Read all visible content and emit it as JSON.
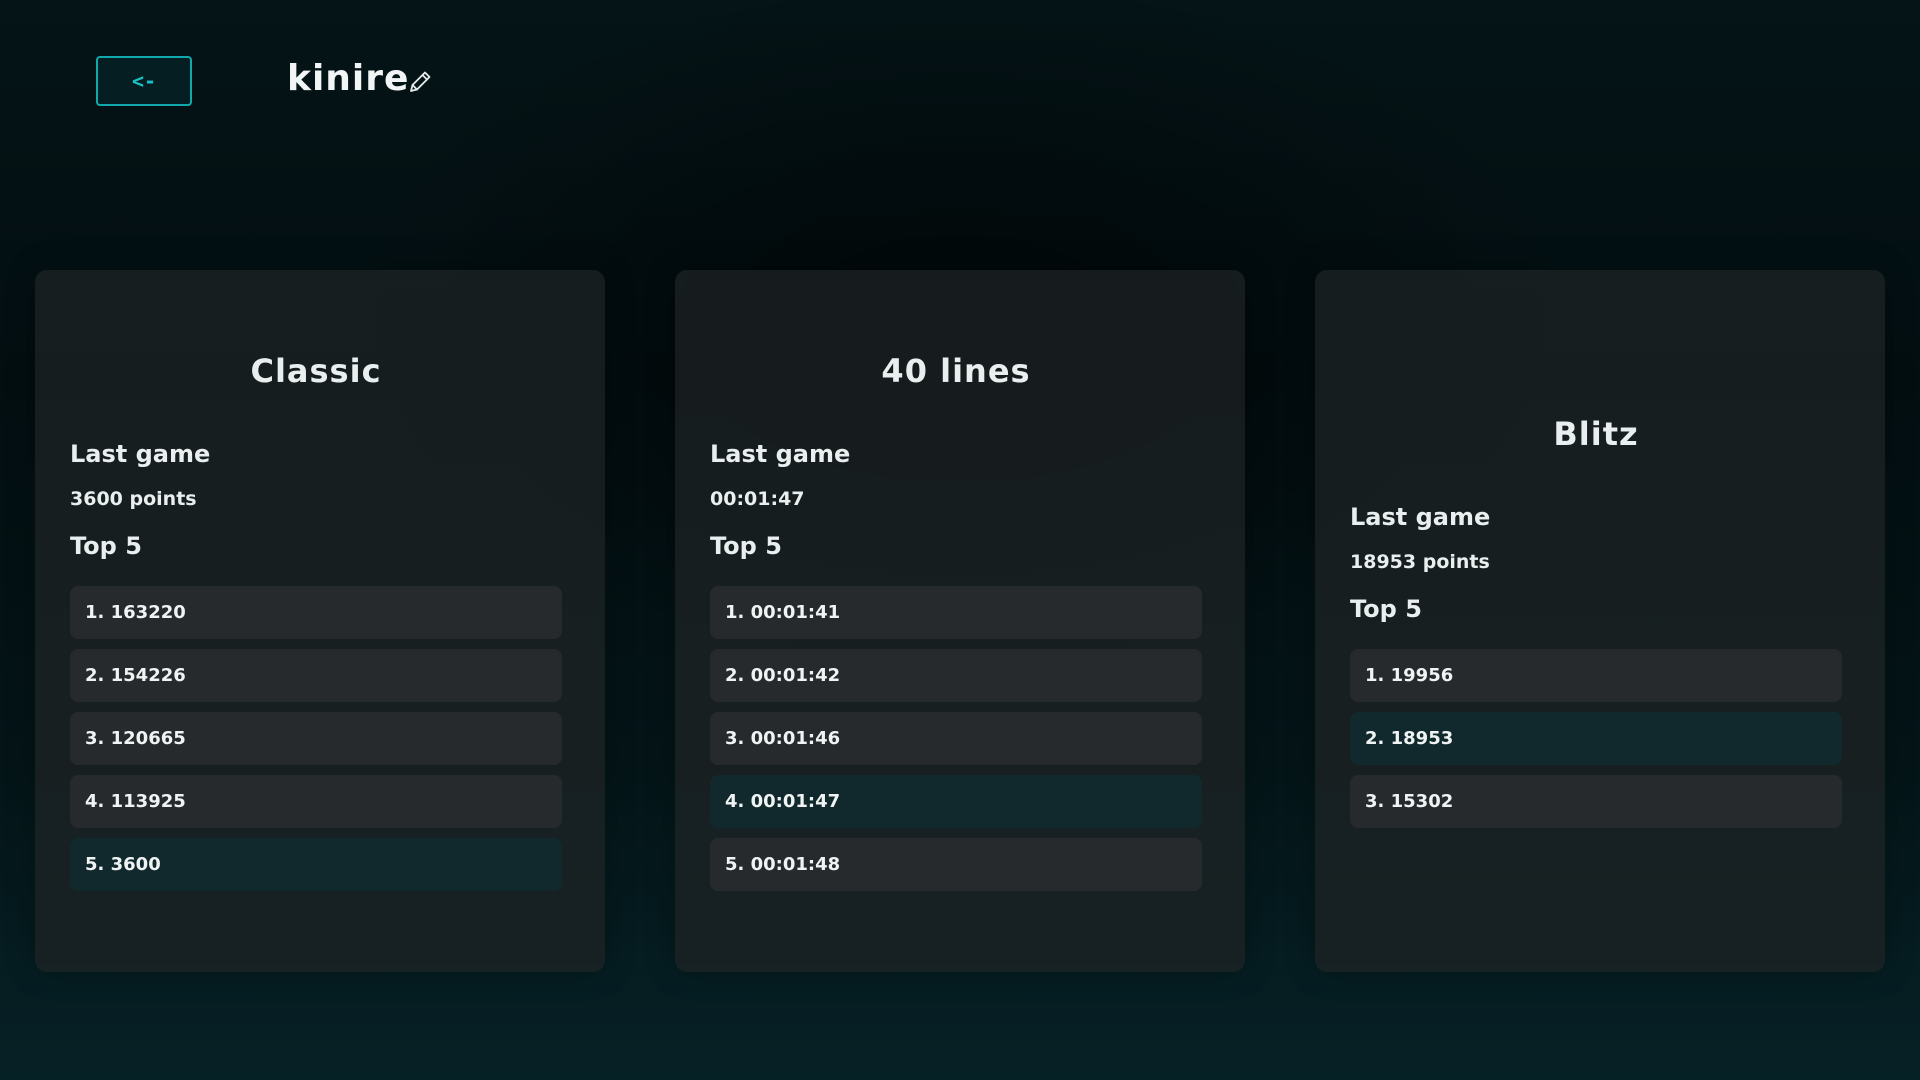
{
  "header": {
    "back_label": "<-",
    "profile_name": "kinire",
    "edit_icon": "pencil-icon"
  },
  "accent_color": "#12a8ad",
  "cards": [
    {
      "title": "Classic",
      "last_game_heading": "Last game",
      "last_game_value": "3600 points",
      "top_heading": "Top 5",
      "ranks": [
        "1. 163220",
        "2. 154226",
        "3. 120665",
        "4. 113925",
        "5. 3600"
      ],
      "current_index": 4
    },
    {
      "title": "40 lines",
      "last_game_heading": "Last game",
      "last_game_value": "00:01:47",
      "top_heading": "Top 5",
      "ranks": [
        "1. 00:01:41",
        "2. 00:01:42",
        "3. 00:01:46",
        "4. 00:01:47",
        "5. 00:01:48"
      ],
      "current_index": 3
    },
    {
      "title": "Blitz",
      "last_game_heading": "Last game",
      "last_game_value": "18953 points",
      "top_heading": "Top 5",
      "ranks": [
        "1. 19956",
        "2. 18953",
        "3. 15302"
      ],
      "current_index": 1
    }
  ]
}
